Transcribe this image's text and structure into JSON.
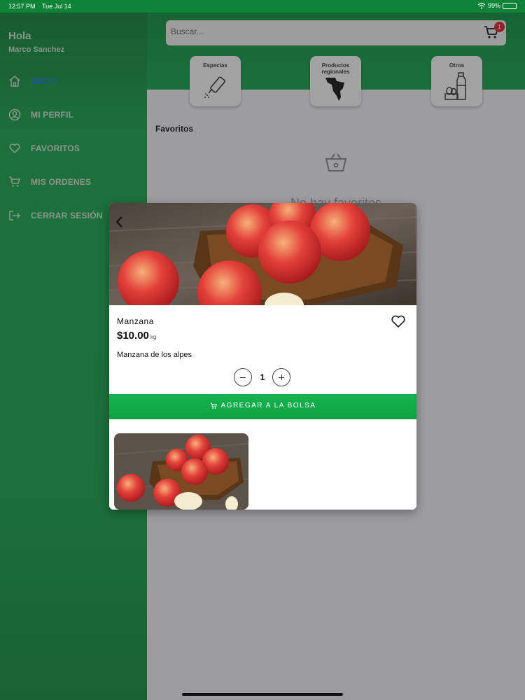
{
  "status_bar": {
    "time": "12:57 PM",
    "date": "Tue Jul 14",
    "battery": "99%",
    "battery_level": 0.99
  },
  "search": {
    "placeholder": "Buscar...",
    "value": ""
  },
  "cart": {
    "count": "1",
    "icon": "cart-icon"
  },
  "categories": [
    {
      "label": "Especias",
      "icon": "spice-shaker-icon"
    },
    {
      "label": "Productos regionales",
      "icon": "regional-map-icon"
    },
    {
      "label": "Otros",
      "icon": "bottle-eggs-icon"
    }
  ],
  "favorites": {
    "title": "Favoritos",
    "empty_text": "No hay favoritos",
    "empty_icon": "basket-icon"
  },
  "sidebar": {
    "greeting": "Hola",
    "user": "Marco Sanchez",
    "items": [
      {
        "label": "INICIO",
        "icon": "home-icon",
        "active": true
      },
      {
        "label": "MI PERFIL",
        "icon": "user-icon"
      },
      {
        "label": "FAVORITOS",
        "icon": "heart-icon"
      },
      {
        "label": "MIS ORDENES",
        "icon": "cart-icon"
      },
      {
        "label": "CERRAR SESIÓN",
        "icon": "logout-icon"
      }
    ]
  },
  "product": {
    "name": "Manzana",
    "price": "$10.00",
    "unit": "kg",
    "description": "Manzana de los alpes",
    "quantity": "1",
    "add_label": "AGREGAR A LA BOLSA"
  },
  "colors": {
    "brand_green": "#12a448",
    "accent_blue": "#1b7fd4",
    "badge_red": "#d9232e"
  }
}
